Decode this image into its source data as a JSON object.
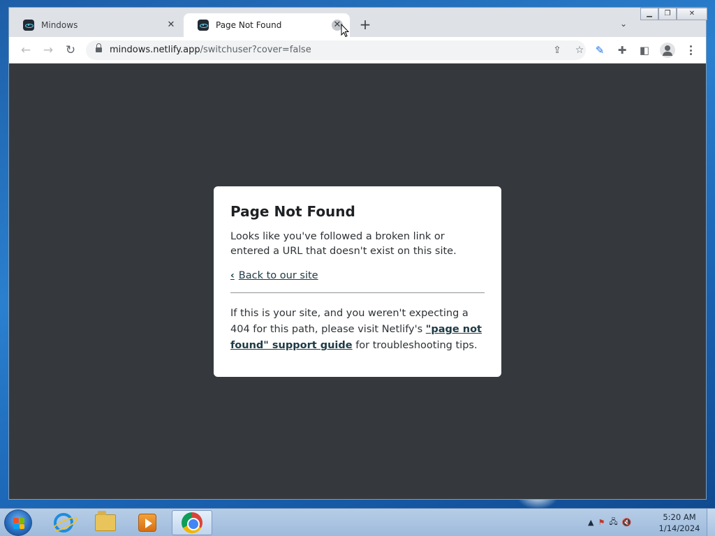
{
  "browser": {
    "tabs": [
      {
        "title": "Mindows",
        "active": false
      },
      {
        "title": "Page Not Found",
        "active": true
      }
    ],
    "new_tab_label": "+",
    "tab_close_glyph": "✕",
    "address": {
      "domain": "mindows.netlify.app",
      "path": "/switchuser?cover=false"
    },
    "icons": {
      "back": "back-arrow-icon",
      "forward": "forward-arrow-icon",
      "reload": "reload-icon",
      "lock": "lock-icon",
      "share": "share-icon",
      "bookmark": "star-icon",
      "extension_a": "feather-icon",
      "extensions": "puzzle-icon",
      "side_panel": "side-panel-icon",
      "profile": "profile-icon",
      "menu": "kebab-menu-icon"
    }
  },
  "page": {
    "title": "Page Not Found",
    "message": "Looks like you've followed a broken link or entered a URL that doesn't exist on this site.",
    "back_link": "Back to our site",
    "footer_before": "If this is your site, and you weren't expecting a 404 for this path, please visit Netlify's ",
    "footer_link": "\"page not found\" support guide",
    "footer_after": " for troubleshooting tips.",
    "background_color": "#35393e",
    "card_color": "#ffffff",
    "link_color": "#1e3a45"
  },
  "taskbar": {
    "pinned": [
      "start-button",
      "internet-explorer",
      "file-explorer",
      "windows-media-player",
      "google-chrome"
    ],
    "active_app": "google-chrome",
    "clock": {
      "time": "5:20 AM",
      "date": "1/14/2024"
    },
    "tray_icons": [
      "show-hidden-icons",
      "action-center-flag-icon",
      "network-icon",
      "volume-muted-icon"
    ]
  }
}
